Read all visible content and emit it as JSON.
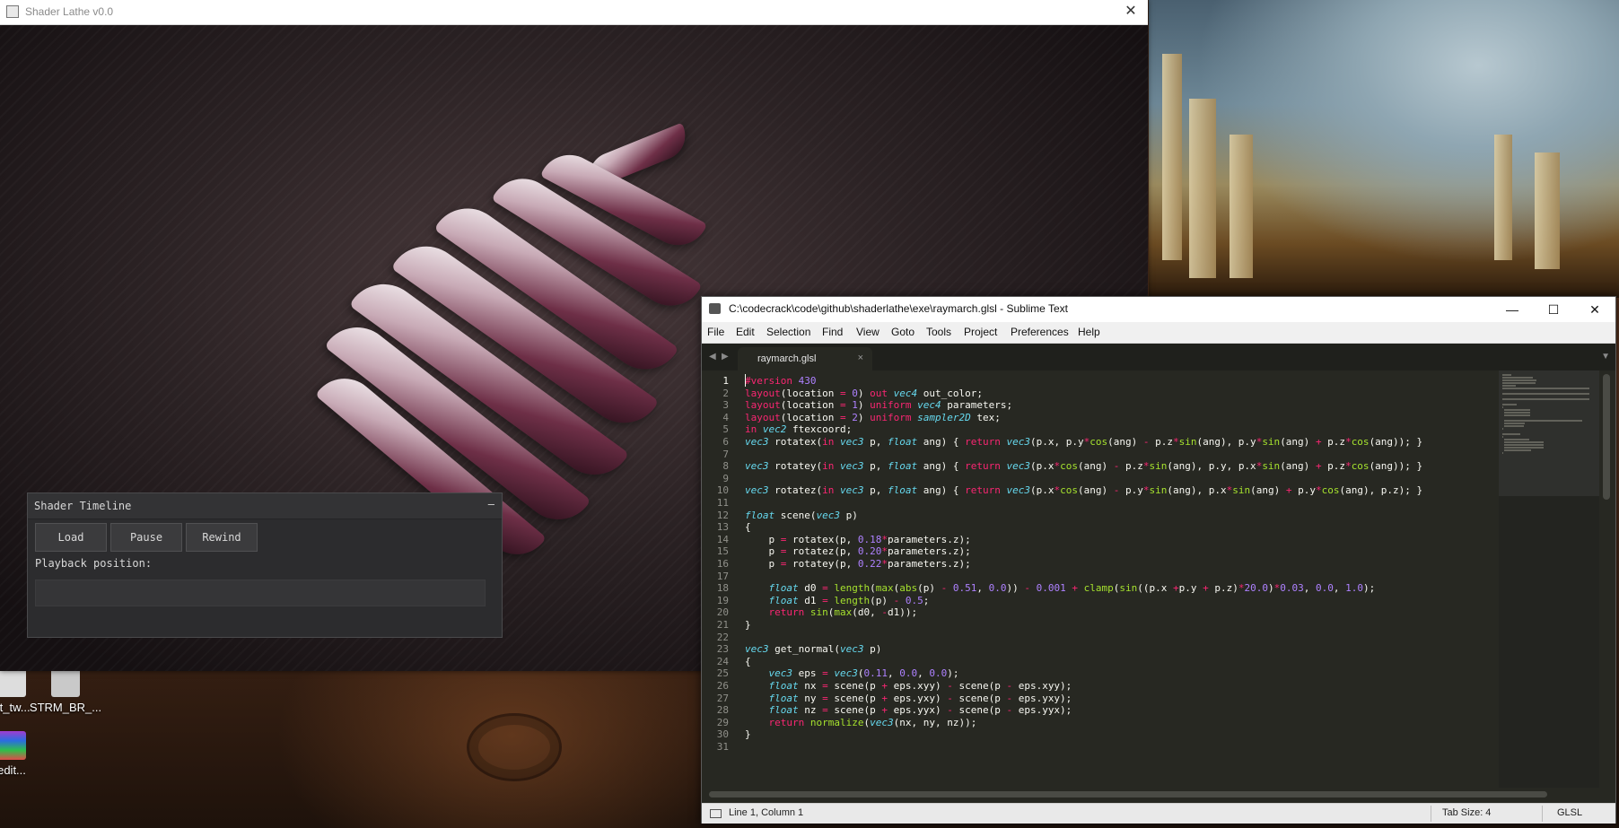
{
  "desktop": {
    "icons": [
      {
        "label": "at_tw..."
      },
      {
        "label": "STRM_BR_..."
      },
      {
        "label": "edit..."
      }
    ]
  },
  "lathe": {
    "title": "Shader Lathe v0.0",
    "close_glyph": "✕"
  },
  "timeline": {
    "title": "Shader Timeline",
    "collapse_glyph": "–",
    "buttons": {
      "load": "Load",
      "pause": "Pause",
      "rewind": "Rewind"
    },
    "playback_label": "Playback position:",
    "playback_position": 0
  },
  "sublime": {
    "title": "C:\\codecrack\\code\\github\\shaderlathe\\exe\\raymarch.glsl - Sublime Text",
    "controls": {
      "minimize": "—",
      "maximize": "☐",
      "close": "✕"
    },
    "menu": [
      "File",
      "Edit",
      "Selection",
      "Find",
      "View",
      "Goto",
      "Tools",
      "Project",
      "Preferences",
      "Help"
    ],
    "tab": {
      "label": "raymarch.glsl",
      "close_glyph": "×"
    },
    "nav": {
      "left": "◀",
      "right": "▶",
      "dropdown": "▼"
    },
    "status": {
      "position": "Line 1, Column 1",
      "tab_size": "Tab Size: 4",
      "syntax": "GLSL"
    },
    "lines": [
      "#version 430",
      "layout(location = 0) out vec4 out_color;",
      "layout(location = 1) uniform vec4 parameters;",
      "layout(location = 2) uniform sampler2D tex;",
      "in vec2 ftexcoord;",
      "vec3 rotatex(in vec3 p, float ang) { return vec3(p.x, p.y*cos(ang) - p.z*sin(ang), p.y*sin(ang) + p.z*cos(ang)); }",
      "",
      "vec3 rotatey(in vec3 p, float ang) { return vec3(p.x*cos(ang) - p.z*sin(ang), p.y, p.x*sin(ang) + p.z*cos(ang)); }",
      "",
      "vec3 rotatez(in vec3 p, float ang) { return vec3(p.x*cos(ang) - p.y*sin(ang), p.x*sin(ang) + p.y*cos(ang), p.z); }",
      "",
      "float scene(vec3 p)",
      "{",
      "    p = rotatex(p, 0.18*parameters.z);",
      "    p = rotatez(p, 0.20*parameters.z);",
      "    p = rotatey(p, 0.22*parameters.z);",
      "",
      "    float d0 = length(max(abs(p) - 0.51, 0.0)) - 0.001 + clamp(sin((p.x +p.y + p.z)*20.0)*0.03, 0.0, 1.0);",
      "    float d1 = length(p) - 0.5;",
      "    return sin(max(d0, -d1));",
      "}",
      "",
      "vec3 get_normal(vec3 p)",
      "{",
      "    vec3 eps = vec3(0.11, 0.0, 0.0);",
      "    float nx = scene(p + eps.xyy) - scene(p - eps.xyy);",
      "    float ny = scene(p + eps.yxy) - scene(p - eps.yxy);",
      "    float nz = scene(p + eps.yyx) - scene(p - eps.yyx);",
      "    return normalize(vec3(nx, ny, nz));",
      "}",
      ""
    ]
  },
  "colors": {
    "editor_bg": "#272822",
    "keyword": "#f92672",
    "type": "#66d9ef",
    "number": "#ae81ff",
    "function": "#a6e22e"
  }
}
